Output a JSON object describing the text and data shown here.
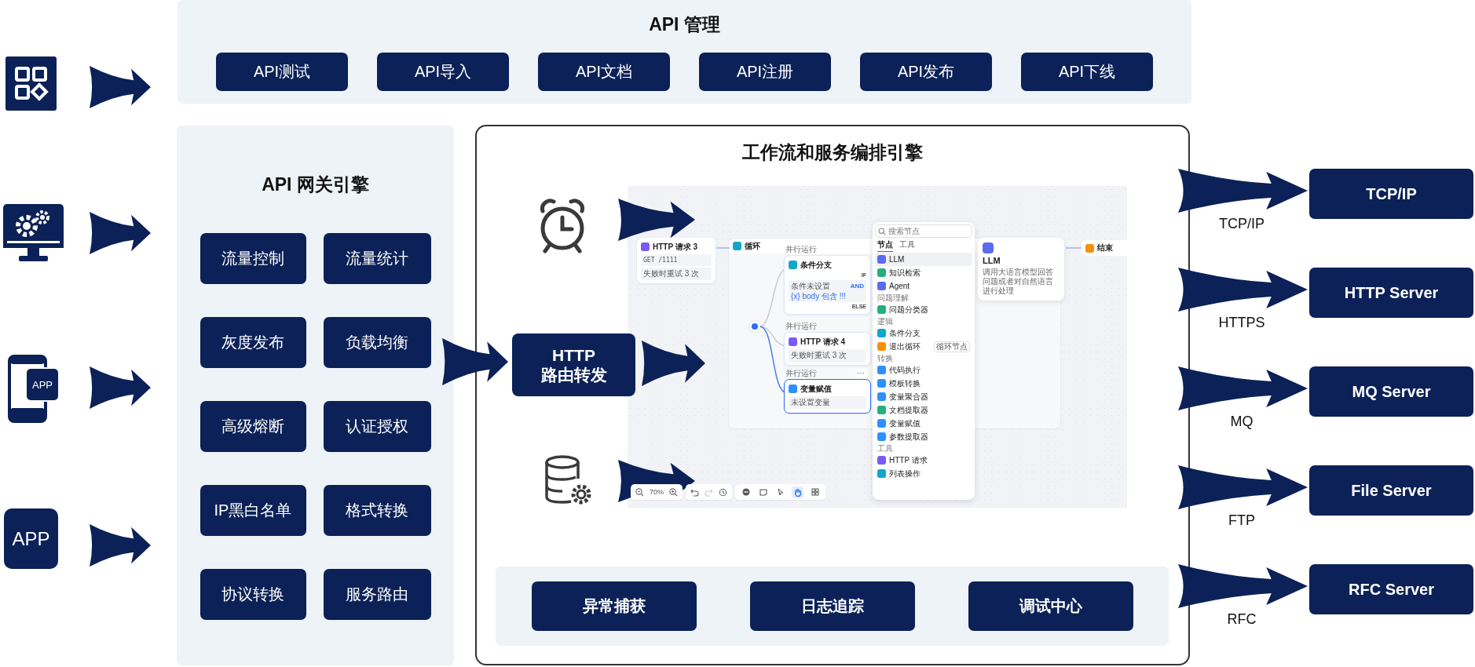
{
  "api_management": {
    "title": "API 管理",
    "buttons": [
      "API测试",
      "API导入",
      "API文档",
      "API注册",
      "API发布",
      "API下线"
    ]
  },
  "clients": [
    {
      "kind": "apps"
    },
    {
      "kind": "monitor"
    },
    {
      "kind": "phone",
      "label": "APP"
    },
    {
      "kind": "tile",
      "label": "APP"
    }
  ],
  "gateway": {
    "title": "API 网关引擎",
    "features": [
      "流量控制",
      "流量统计",
      "灰度发布",
      "负载均衡",
      "高级熔断",
      "认证授权",
      "IP黑白名单",
      "格式转换",
      "协议转换",
      "服务路由"
    ]
  },
  "workflow": {
    "title": "工作流和服务编排引擎",
    "router": [
      "HTTP",
      "路由转发"
    ],
    "editor": {
      "request_node": {
        "title": "HTTP 请求 3",
        "method": "GET",
        "path": "/1111",
        "retry": "失败时重试 3 次"
      },
      "loop": {
        "title": "循环",
        "branches": [
          {
            "kind": "condition",
            "tag": "并行运行",
            "title": "条件分支",
            "if": "IF",
            "condition": "条件未设置",
            "operator": "AND",
            "expression": "{x} body 包含 !!!",
            "else": "ELSE",
            "selected": false
          },
          {
            "kind": "http",
            "tag": "并行运行",
            "title": "HTTP 请求 4",
            "detail": "失败时重试 3 次",
            "selected": false
          },
          {
            "kind": "assign",
            "tag": "并行运行",
            "title": "变量赋值",
            "detail": "未设置变量",
            "more": "···",
            "selected": true
          }
        ]
      },
      "end_node": {
        "title": "结束"
      },
      "tooltip": {
        "title": "LLM",
        "description": "调用大语言模型回答问题或者对自然语言进行处理"
      },
      "menu": {
        "placeholder": "搜索节点",
        "tabs": [
          {
            "label": "节点",
            "selected": true
          },
          {
            "label": "工具",
            "selected": false
          }
        ],
        "items": [
          {
            "kind": "node",
            "label": "LLM",
            "color": "#5b6cf0",
            "selected": true
          },
          {
            "kind": "node",
            "label": "知识检索",
            "color": "#22b07d",
            "selected": false
          },
          {
            "kind": "node",
            "label": "Agent",
            "color": "#5b6cf0",
            "selected": false
          },
          {
            "kind": "heading",
            "label": "问题理解"
          },
          {
            "kind": "node",
            "label": "问题分类器",
            "color": "#22b07d",
            "selected": false
          },
          {
            "kind": "heading",
            "label": "逻辑"
          },
          {
            "kind": "node",
            "label": "条件分支",
            "color": "#10a7c9",
            "selected": false
          },
          {
            "kind": "node",
            "label": "退出循环",
            "color": "#f79009",
            "selected": false,
            "tag": "循环节点"
          },
          {
            "kind": "heading",
            "label": "转换"
          },
          {
            "kind": "node",
            "label": "代码执行",
            "color": "#2e90fa",
            "selected": false
          },
          {
            "kind": "node",
            "label": "模板转换",
            "color": "#2e90fa",
            "selected": false
          },
          {
            "kind": "node",
            "label": "变量聚合器",
            "color": "#2e90fa",
            "selected": false
          },
          {
            "kind": "node",
            "label": "文档提取器",
            "color": "#22b07d",
            "selected": false
          },
          {
            "kind": "node",
            "label": "变量赋值",
            "color": "#2e90fa",
            "selected": false
          },
          {
            "kind": "node",
            "label": "参数提取器",
            "color": "#2e90fa",
            "selected": false
          },
          {
            "kind": "heading",
            "label": "工具"
          },
          {
            "kind": "node",
            "label": "HTTP 请求",
            "color": "#7a5af8",
            "selected": false
          },
          {
            "kind": "node",
            "label": "列表操作",
            "color": "#10a7c9",
            "selected": false
          }
        ]
      },
      "toolbar": {
        "zoom": "70%",
        "tools": [
          {
            "kind": "add",
            "selected": false
          },
          {
            "kind": "note",
            "selected": false
          },
          {
            "kind": "pointer",
            "selected": false
          },
          {
            "kind": "hand",
            "selected": true
          },
          {
            "kind": "layout",
            "selected": false
          }
        ]
      }
    },
    "tools": [
      "异常捕获",
      "日志追踪",
      "调试中心"
    ]
  },
  "backends": [
    {
      "protocol": "TCP/IP",
      "server": "TCP/IP"
    },
    {
      "protocol": "HTTPS",
      "server": "HTTP Server"
    },
    {
      "protocol": "MQ",
      "server": "MQ Server"
    },
    {
      "protocol": "FTP",
      "server": "File Server"
    },
    {
      "protocol": "RFC",
      "server": "RFC Server"
    }
  ]
}
